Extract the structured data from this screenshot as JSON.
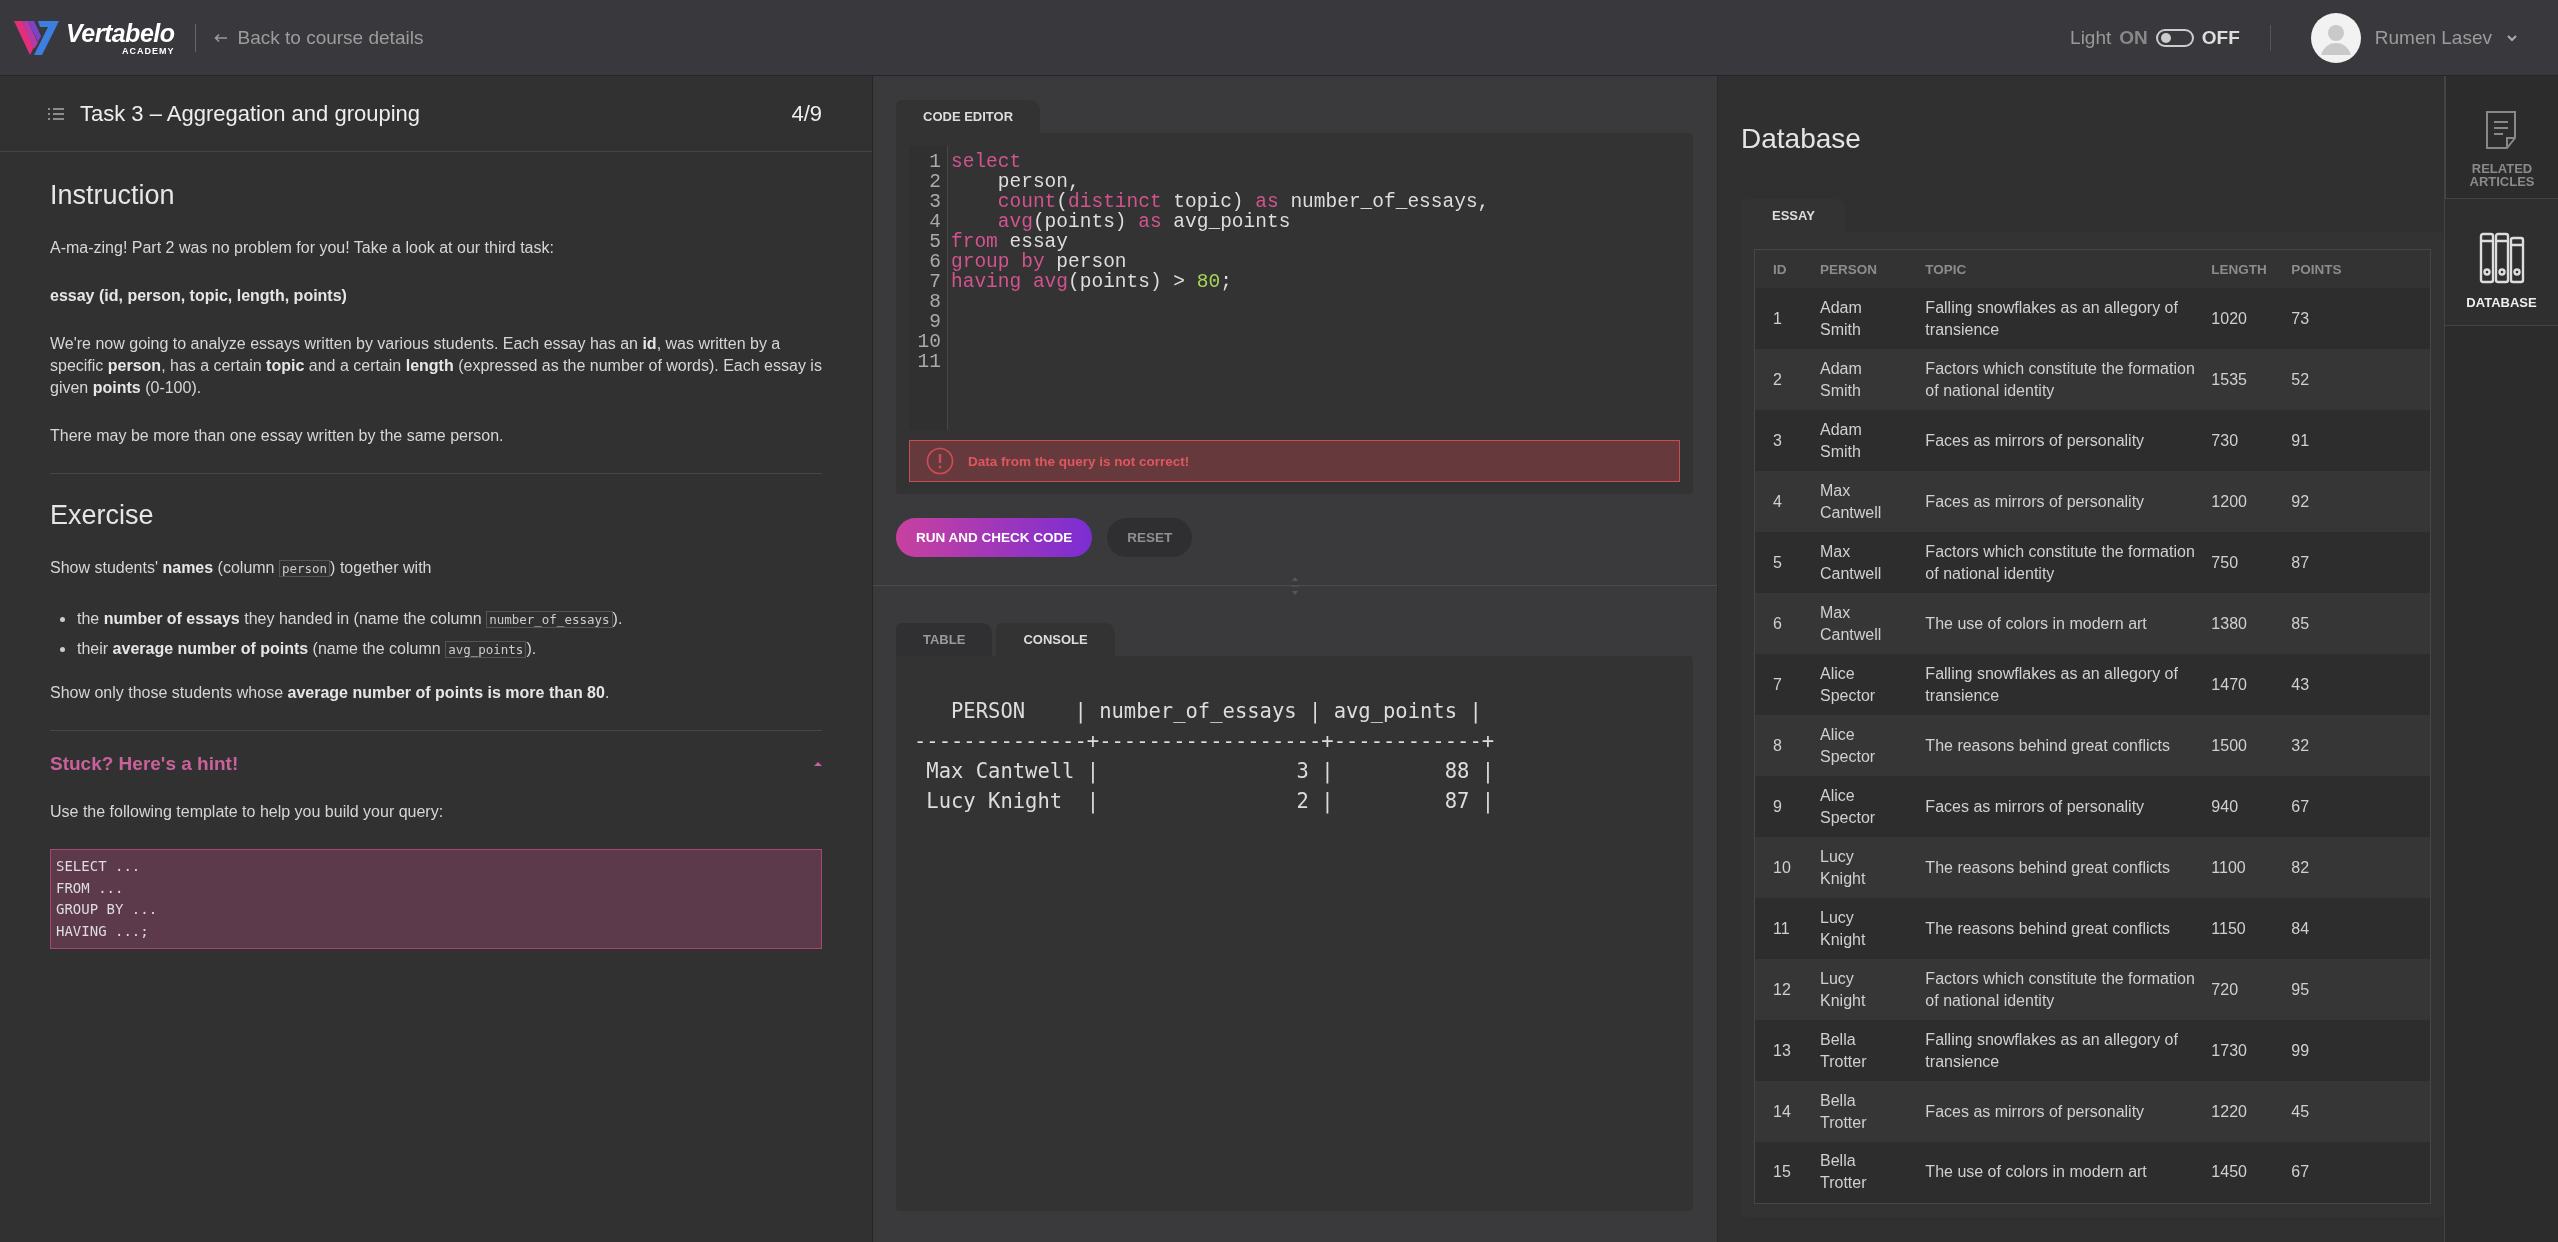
{
  "header": {
    "brand": {
      "name": "Vertabelo",
      "subtitle": "ACADEMY"
    },
    "back_link": "Back to course details",
    "light_switch": {
      "label": "Light",
      "on_label": "ON",
      "off_label": "OFF",
      "on": false
    },
    "user": {
      "name": "Rumen Lasev"
    }
  },
  "task": {
    "title": "Task 3 – Aggregation and grouping",
    "progress": "4/9",
    "sections": [
      {
        "heading": "Instruction",
        "blocks": [
          {
            "kind": "paragraph",
            "segments": [
              {
                "kind": "text",
                "text": "A-ma-zing! Part 2 was no problem for you! Take a look at our third task:"
              }
            ]
          },
          {
            "kind": "paragraph",
            "segments": [
              {
                "kind": "text",
                "text": "**essay (id, person, topic, length, points)**"
              }
            ]
          },
          {
            "kind": "paragraph",
            "segments": [
              {
                "kind": "text",
                "text": "We're now going to analyze essays written by various students. Each essay has an **id**, was written by a specific **person**, has a certain **topic** and a certain **length** (expressed as the number of words). Each essay is given **points** (0-100)."
              }
            ]
          },
          {
            "kind": "paragraph",
            "segments": [
              {
                "kind": "text",
                "text": "There may be more than one essay written by the same person."
              }
            ]
          }
        ]
      },
      {
        "heading": "Exercise",
        "blocks": [
          {
            "kind": "paragraph",
            "segments": [
              {
                "kind": "text",
                "text": "Show students' **names** (column "
              },
              {
                "kind": "code",
                "text": "person"
              },
              {
                "kind": "text",
                "text": ") together with"
              }
            ]
          },
          {
            "kind": "list",
            "items": [
              {
                "segments": [
                  {
                    "kind": "text",
                    "text": "the **number of essays** they handed in (name the column "
                  },
                  {
                    "kind": "code",
                    "text": "number_of_essays"
                  },
                  {
                    "kind": "text",
                    "text": ")."
                  }
                ]
              },
              {
                "segments": [
                  {
                    "kind": "text",
                    "text": "their **average number of points** (name the column "
                  },
                  {
                    "kind": "code",
                    "text": "avg_points"
                  },
                  {
                    "kind": "text",
                    "text": ")."
                  }
                ]
              }
            ]
          },
          {
            "kind": "paragraph",
            "segments": [
              {
                "kind": "text",
                "text": "Show only those students whose **average number of points is more than 80**."
              }
            ]
          }
        ]
      }
    ],
    "hint": {
      "title": "Stuck? Here's a hint!",
      "expanded": true,
      "text": "Use the following template to help you build your query:",
      "code": [
        "SELECT ...",
        "FROM ...",
        "GROUP BY ...",
        "HAVING ...;"
      ]
    }
  },
  "editor": {
    "tab": "CODE EDITOR",
    "lines": [
      {
        "number": "1",
        "tokens": [
          {
            "kind": "keyword",
            "text": "select"
          }
        ]
      },
      {
        "number": "2",
        "tokens": [
          {
            "kind": "plain",
            "text": "    person,"
          }
        ]
      },
      {
        "number": "3",
        "tokens": [
          {
            "kind": "keyword",
            "text": "    count"
          },
          {
            "kind": "plain",
            "text": "("
          },
          {
            "kind": "keyword",
            "text": "distinct"
          },
          {
            "kind": "plain",
            "text": " topic) "
          },
          {
            "kind": "keyword",
            "text": "as"
          },
          {
            "kind": "plain",
            "text": " number_of_essays,"
          }
        ]
      },
      {
        "number": "4",
        "tokens": [
          {
            "kind": "keyword",
            "text": "    avg"
          },
          {
            "kind": "plain",
            "text": "(points) "
          },
          {
            "kind": "keyword",
            "text": "as"
          },
          {
            "kind": "plain",
            "text": " avg_points"
          }
        ]
      },
      {
        "number": "5",
        "tokens": [
          {
            "kind": "keyword",
            "text": "from"
          },
          {
            "kind": "plain",
            "text": " essay"
          }
        ]
      },
      {
        "number": "6",
        "tokens": [
          {
            "kind": "keyword",
            "text": "group by"
          },
          {
            "kind": "plain",
            "text": " person"
          }
        ]
      },
      {
        "number": "7",
        "tokens": [
          {
            "kind": "keyword",
            "text": "having avg"
          },
          {
            "kind": "plain",
            "text": "(points) > "
          },
          {
            "kind": "number",
            "text": "80"
          },
          {
            "kind": "plain",
            "text": ";"
          }
        ]
      },
      {
        "number": "8"
      },
      {
        "number": "9"
      },
      {
        "number": "10"
      },
      {
        "number": "11"
      }
    ],
    "message": {
      "kind": "error",
      "text": "Data from the query is not correct!"
    },
    "buttons": [
      {
        "kind": "primary",
        "label": "RUN AND CHECK CODE"
      },
      {
        "kind": "secondary",
        "label": "RESET"
      }
    ]
  },
  "output": {
    "tabs": [
      {
        "label": "TABLE",
        "selected": false
      },
      {
        "label": "CONSOLE",
        "selected": true
      }
    ],
    "console": [
      "   PERSON    | number_of_essays | avg_points |",
      "--------------+------------------+------------+",
      " Max Cantwell |                3 |         88 |",
      " Lucy Knight  |                2 |         87 |"
    ]
  },
  "database": {
    "title": "Database",
    "tables": [
      {
        "label": "ESSAY",
        "selected": true
      }
    ],
    "columns": [
      "ID",
      "PERSON",
      "TOPIC",
      "LENGTH",
      "POINTS"
    ],
    "rows": [
      [
        "1",
        "Adam Smith",
        "Falling snowflakes as an allegory of transience",
        "1020",
        "73"
      ],
      [
        "2",
        "Adam Smith",
        "Factors which constitute the formation of national identity",
        "1535",
        "52"
      ],
      [
        "3",
        "Adam Smith",
        "Faces as mirrors of personality",
        "730",
        "91"
      ],
      [
        "4",
        "Max Cantwell",
        "Faces as mirrors of personality",
        "1200",
        "92"
      ],
      [
        "5",
        "Max Cantwell",
        "Factors which constitute the formation of national identity",
        "750",
        "87"
      ],
      [
        "6",
        "Max Cantwell",
        "The use of colors in modern art",
        "1380",
        "85"
      ],
      [
        "7",
        "Alice Spector",
        "Falling snowflakes as an allegory of transience",
        "1470",
        "43"
      ],
      [
        "8",
        "Alice Spector",
        "The reasons behind great conflicts",
        "1500",
        "32"
      ],
      [
        "9",
        "Alice Spector",
        "Faces as mirrors of personality",
        "940",
        "67"
      ],
      [
        "10",
        "Lucy Knight",
        "The reasons behind great conflicts",
        "1100",
        "82"
      ],
      [
        "11",
        "Lucy Knight",
        "The reasons behind great conflicts",
        "1150",
        "84"
      ],
      [
        "12",
        "Lucy Knight",
        "Factors which constitute the formation of national identity",
        "720",
        "95"
      ],
      [
        "13",
        "Bella Trotter",
        "Falling snowflakes as an allegory of transience",
        "1730",
        "99"
      ],
      [
        "14",
        "Bella Trotter",
        "Faces as mirrors of personality",
        "1220",
        "45"
      ],
      [
        "15",
        "Bella Trotter",
        "The use of colors in modern art",
        "1450",
        "67"
      ]
    ]
  },
  "side_nav": [
    {
      "kind": "articles",
      "label": "RELATED ARTICLES",
      "selected": false
    },
    {
      "kind": "database",
      "label": "DATABASE",
      "selected": true
    }
  ]
}
